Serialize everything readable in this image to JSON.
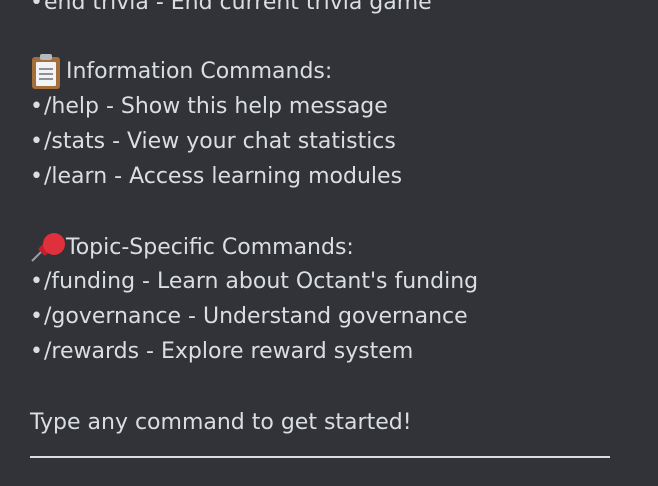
{
  "top_line": "end trivia - End current trivia game",
  "bullet": "•",
  "sections": {
    "information": {
      "icon": "clipboard-icon",
      "title": "Information Commands:",
      "items": [
        "/help - Show this help message",
        "/stats - View your chat statistics",
        "/learn - Access learning modules"
      ]
    },
    "topic": {
      "icon": "pushpin-icon",
      "title": "Topic-Specific Commands:",
      "items": [
        "/funding - Learn about Octant's funding",
        "/governance - Understand governance",
        "/rewards - Explore reward system"
      ]
    }
  },
  "footer": "Type any command to get started!",
  "colors": {
    "background": "#313338",
    "text": "#dbdee1"
  }
}
